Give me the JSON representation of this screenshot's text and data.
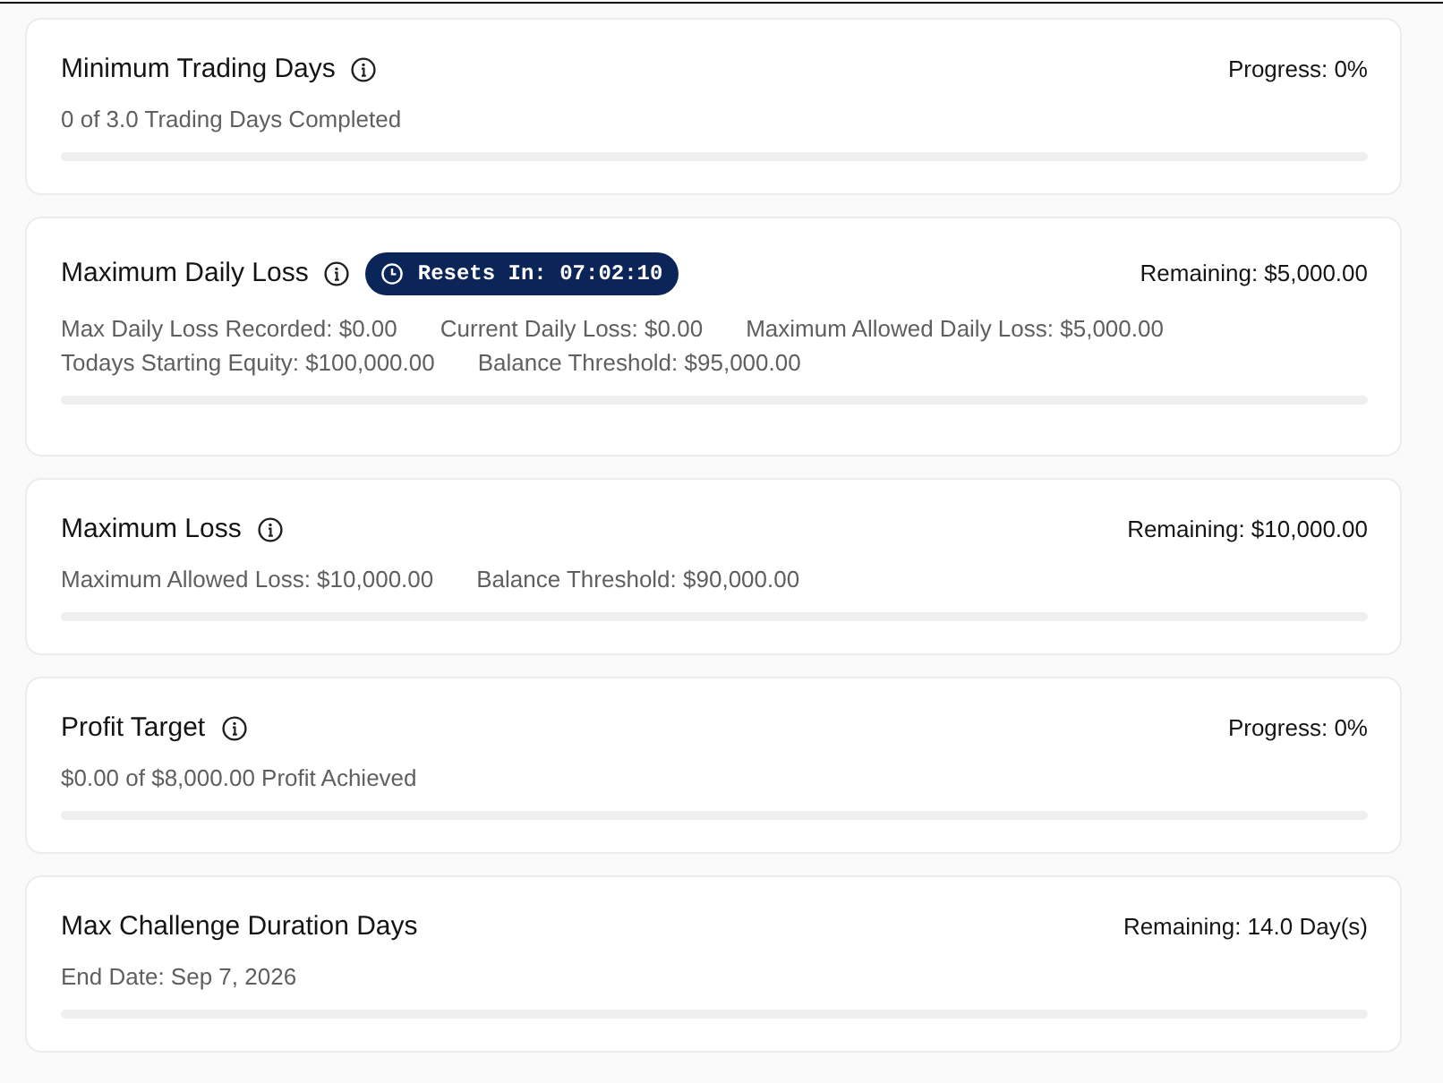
{
  "cards": [
    {
      "title": "Minimum Trading Days",
      "info": true,
      "status": "Progress: 0%",
      "details": [
        [
          "0 of 3.0 Trading Days Completed"
        ]
      ],
      "level": 0
    },
    {
      "title": "Maximum Daily Loss",
      "info": true,
      "badge": {
        "text": "Resets In: 07:02:10"
      },
      "status": "Remaining: $5,000.00",
      "details": [
        [
          "Max Daily Loss Recorded: $0.00",
          "Current Daily Loss: $0.00",
          "Maximum Allowed Daily Loss: $5,000.00"
        ],
        [
          "Todays Starting Equity: $100,000.00",
          "Balance Threshold: $95,000.00"
        ]
      ],
      "level": 0
    },
    {
      "title": "Maximum Loss",
      "info": true,
      "status": "Remaining: $10,000.00",
      "details": [
        [
          "Maximum Allowed Loss: $10,000.00",
          "Balance Threshold: $90,000.00"
        ]
      ],
      "level": 0
    },
    {
      "title": "Profit Target",
      "info": true,
      "status": "Progress: 0%",
      "details": [
        [
          "$0.00 of $8,000.00 Profit Achieved"
        ]
      ],
      "level": 0
    },
    {
      "title": "Max Challenge Duration Days",
      "info": false,
      "status": "Remaining: 14.0 Day(s)",
      "details": [
        [
          "End Date: Sep 7, 2026"
        ]
      ],
      "level": 0
    }
  ]
}
